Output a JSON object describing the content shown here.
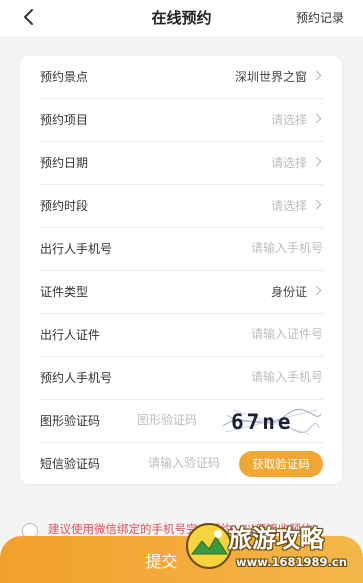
{
  "header": {
    "title": "在线预约",
    "right_link": "预约记录"
  },
  "form": {
    "rows": [
      {
        "label": "预约景点",
        "value": "深圳世界之窗"
      },
      {
        "label": "预约项目",
        "placeholder": "请选择"
      },
      {
        "label": "预约日期",
        "placeholder": "请选择"
      },
      {
        "label": "预约时段",
        "placeholder": "请选择"
      },
      {
        "label": "出行人手机号",
        "placeholder": "请输入手机号"
      },
      {
        "label": "证件类型",
        "value": "身份证"
      },
      {
        "label": "出行人证件",
        "placeholder": "请输入证件号"
      },
      {
        "label": "预约人手机号",
        "placeholder": "请输入手机号"
      },
      {
        "label": "图形验证码",
        "placeholder": "图形验证码",
        "captcha_text": "67ne"
      },
      {
        "label": "短信验证码",
        "placeholder": "请输入验证码",
        "button": "获取验证码"
      }
    ]
  },
  "agreement": {
    "text": "建议使用微信绑定的手机号完成预约，以便接收预约"
  },
  "submit": {
    "label": "提交"
  },
  "watermark": {
    "title": "旅游攻略",
    "url": "www.1681989.cn"
  },
  "colors": {
    "accent": "#f0a734",
    "notice": "#e84c5a",
    "placeholder": "#bdbdbd"
  }
}
